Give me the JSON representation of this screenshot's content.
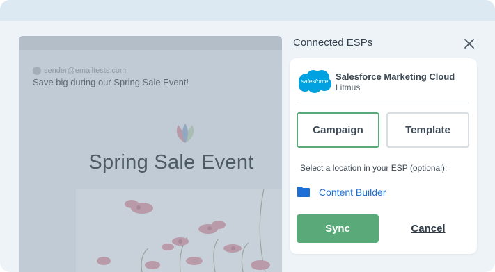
{
  "preview": {
    "sender_email": "sender@emailtests.com",
    "subject": "Save big during our Spring Sale Event!",
    "headline": "Spring Sale Event"
  },
  "panel": {
    "title": "Connected ESPs",
    "close_icon": "close-icon"
  },
  "esp": {
    "logo_text": "salesforce",
    "name": "Salesforce Marketing Cloud",
    "account": "Litmus"
  },
  "tabs": [
    {
      "label": "Campaign",
      "selected": true
    },
    {
      "label": "Template",
      "selected": false
    }
  ],
  "location": {
    "label": "Select a location in your ESP (optional):",
    "folder_icon": "folder-icon",
    "folder_name": "Content Builder"
  },
  "actions": {
    "sync_label": "Sync",
    "cancel_label": "Cancel"
  },
  "colors": {
    "accent_green": "#5aa978",
    "link_blue": "#1e6fd6",
    "salesforce_blue": "#00a1e0",
    "overlay_gray": "#c0cbd5"
  }
}
